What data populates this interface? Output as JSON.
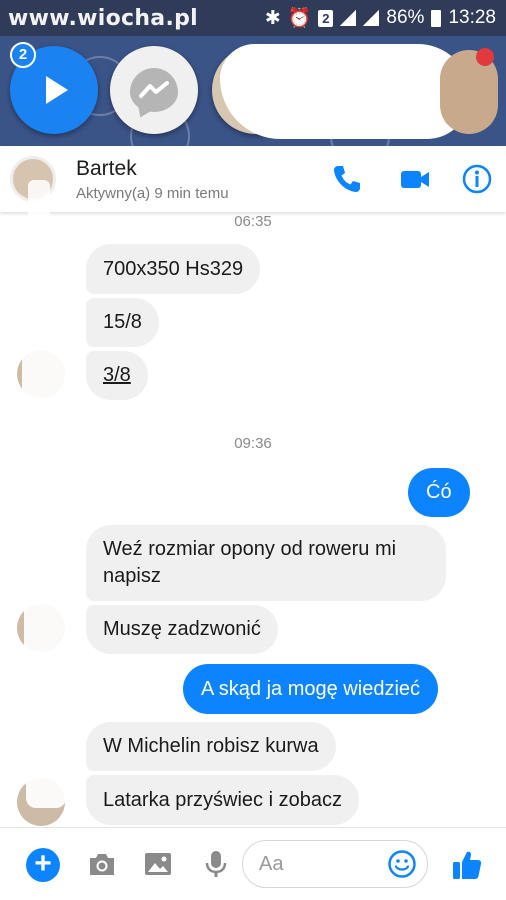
{
  "status_bar": {
    "watermark": "www.wiocha.pl",
    "sim_badge": "2",
    "battery": "86%",
    "time": "13:28"
  },
  "chat_heads": {
    "unread_count": "2"
  },
  "header": {
    "contact_name": "Bartek",
    "active_status": "Aktywny(a) 9 min temu"
  },
  "messages": {
    "timestamp_1": "06:35",
    "timestamp_2": "09:36",
    "m1": "700x350 Hs329",
    "m2": "15/8",
    "m3": "3/8",
    "m4": "Ćó",
    "m5": "Weź rozmiar opony od roweru mi napisz",
    "m6": "Muszę zadzwonić",
    "m7": "A skąd  ja mogę wiedzieć",
    "m8": "W Michelin robisz kurwa",
    "m9": "Latarka przyświec i zobacz"
  },
  "composer": {
    "plus_label": "+",
    "placeholder": "Aa"
  },
  "colors": {
    "accent": "#0d84ff",
    "incoming_bubble": "#f0f0f0",
    "heads_bg": "#3b5488"
  },
  "icons": [
    "phone-icon",
    "video-camera-icon",
    "info-icon",
    "camera-icon",
    "image-icon",
    "microphone-icon",
    "emoji-icon",
    "thumbs-up-icon",
    "play-icon",
    "messenger-icon"
  ]
}
